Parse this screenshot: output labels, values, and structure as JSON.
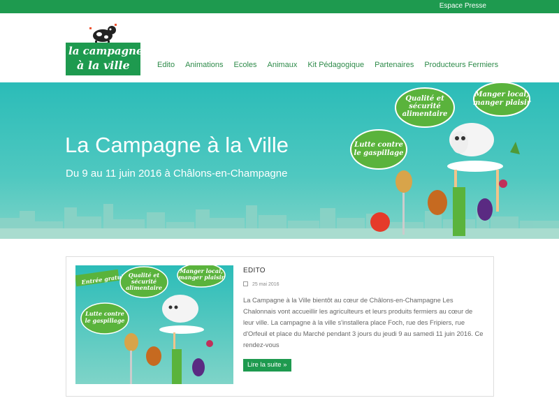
{
  "topbar": {
    "link": "Espace Presse"
  },
  "logo": {
    "line1": "la campagne",
    "line2": "à la ville"
  },
  "nav": [
    "Edito",
    "Animations",
    "Ecoles",
    "Animaux",
    "Kit Pédagogique",
    "Partenaires",
    "Producteurs Fermiers"
  ],
  "hero": {
    "title": "La Campagne à la Ville",
    "subtitle": "Du 9 au 11 juin 2016 à Châlons-en-Champagne",
    "bubbles": [
      "Qualité et sécurité alimentaire",
      "Manger local, manger plaisir",
      "Lutte contre le gaspillage"
    ]
  },
  "article": {
    "title": "EDITO",
    "date": "25 mai 2016",
    "body": "La Campagne à la Ville bientôt au cœur de Châlons-en-Champagne Les Chalonnais vont accueillir les agriculteurs et leurs produits fermiers au cœur de leur ville. La campagne à la ville s'installera place Foch, rue des Fripiers, rue d'Orfeuil et place du Marché pendant 3 jours du jeudi 9 au samedi 11 juin 2016. Ce rendez-vous",
    "read_more": "Lire la suite »",
    "thumb_badge": "Entrée gratuite"
  },
  "colors": {
    "brand_green": "#1e9a4f",
    "hero_teal": "#2bbcb8"
  }
}
